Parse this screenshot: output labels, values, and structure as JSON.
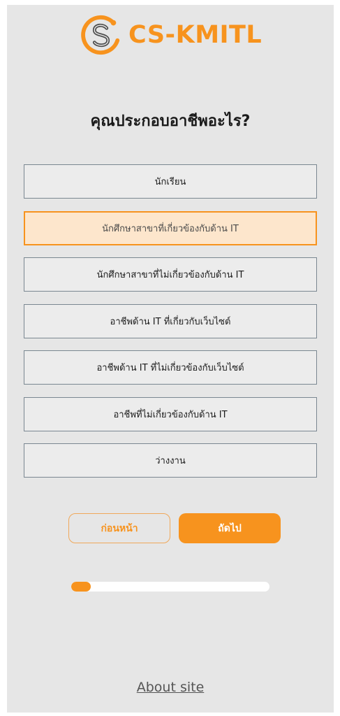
{
  "brand": {
    "name": "CS-KMITL",
    "color": "#f7931e"
  },
  "question": {
    "title": "คุณประกอบอาชีพอะไร?"
  },
  "options": [
    {
      "label": "นักเรียน",
      "selected": false
    },
    {
      "label": "นักศึกษาสาขาที่เกี่ยวข้องกับด้าน IT",
      "selected": true
    },
    {
      "label": "นักศึกษาสาขาที่ไม่เกี่ยวข้องกับด้าน IT",
      "selected": false
    },
    {
      "label": "อาชีพด้าน IT ที่เกี่ยวกับเว็บไซต์",
      "selected": false
    },
    {
      "label": "อาชีพด้าน IT ที่ไม่เกี่ยวข้องกับเว็บไซต์",
      "selected": false
    },
    {
      "label": "อาชีพที่ไม่เกี่ยวข้องกับด้าน IT",
      "selected": false
    },
    {
      "label": "ว่างงาน",
      "selected": false
    }
  ],
  "navigation": {
    "prev_label": "ก่อนหน้า",
    "next_label": "ถัดไป"
  },
  "progress": {
    "fraction": 0.1
  },
  "footer": {
    "about_label": "About site"
  }
}
